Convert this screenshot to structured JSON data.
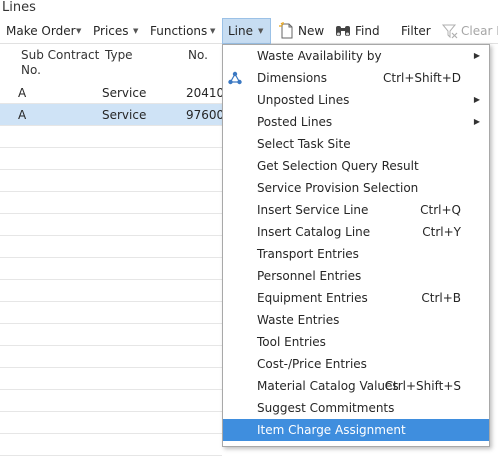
{
  "window": {
    "title": "Lines"
  },
  "toolbar": {
    "make_order": "Make Order",
    "prices": "Prices",
    "functions": "Functions",
    "line": "Line",
    "new": "New",
    "find": "Find",
    "filter": "Filter",
    "clear_filter": "Clear F"
  },
  "grid": {
    "columns": [
      "Sub Contract No.",
      "Type",
      "No."
    ],
    "col1_line1": "Sub Contract",
    "col1_line2": "No.",
    "rows": [
      {
        "sub_contract": "A",
        "type": "Service",
        "no": "20410",
        "selected": false
      },
      {
        "sub_contract": "A",
        "type": "Service",
        "no": "97600",
        "selected": true
      }
    ]
  },
  "menu": {
    "items": [
      {
        "label": "Waste Availability by",
        "shortcut": "",
        "submenu": true
      },
      {
        "label": "Dimensions",
        "shortcut": "Ctrl+Shift+D",
        "icon": "dimensions-icon"
      },
      {
        "label": "Unposted Lines",
        "shortcut": "",
        "submenu": true
      },
      {
        "label": "Posted Lines",
        "shortcut": "",
        "submenu": true
      },
      {
        "label": "Select Task Site",
        "shortcut": ""
      },
      {
        "label": "Get Selection Query Result",
        "shortcut": ""
      },
      {
        "label": "Service Provision Selection",
        "shortcut": ""
      },
      {
        "label": "Insert Service Line",
        "shortcut": "Ctrl+Q"
      },
      {
        "label": "Insert Catalog Line",
        "shortcut": "Ctrl+Y"
      },
      {
        "label": "Transport Entries",
        "shortcut": ""
      },
      {
        "label": "Personnel Entries",
        "shortcut": ""
      },
      {
        "label": "Equipment Entries",
        "shortcut": "Ctrl+B"
      },
      {
        "label": "Waste Entries",
        "shortcut": ""
      },
      {
        "label": "Tool Entries",
        "shortcut": ""
      },
      {
        "label": "Cost-/Price Entries",
        "shortcut": ""
      },
      {
        "label": "Material Catalog Values",
        "shortcut": "Ctrl+Shift+S"
      },
      {
        "label": "Suggest Commitments",
        "shortcut": ""
      },
      {
        "label": "Item Charge Assignment",
        "shortcut": "",
        "highlighted": true
      }
    ]
  },
  "colors": {
    "selection": "#cfe3f6",
    "menu_highlight": "#3f8ede",
    "active_tab": "#c7ddf2"
  }
}
